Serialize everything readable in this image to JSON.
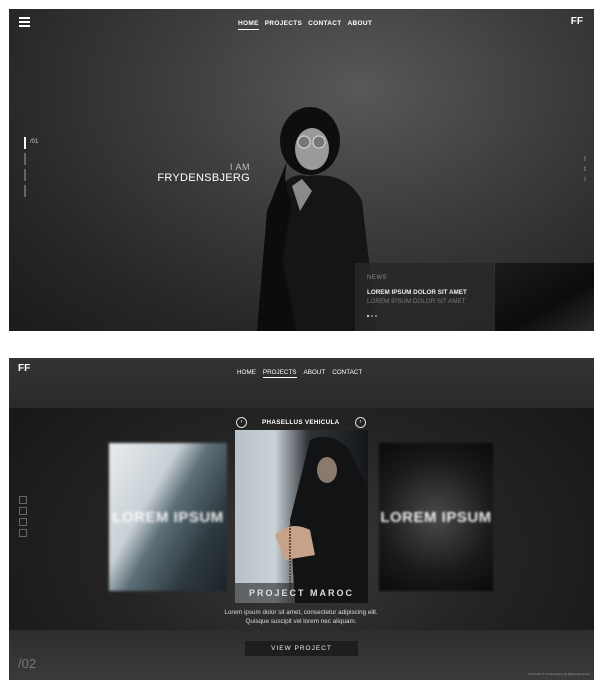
{
  "panel1": {
    "logo": "FF",
    "nav": [
      {
        "label": "HOME",
        "active": true
      },
      {
        "label": "PROJECTS",
        "active": false
      },
      {
        "label": "CONTACT",
        "active": false
      },
      {
        "label": "ABOUT",
        "active": false
      }
    ],
    "slide_number": "/01",
    "hero_line1": "I AM",
    "hero_line2": "FRYDENSBJERG",
    "social": [
      "f",
      "t",
      "i"
    ],
    "news": {
      "label": "NEWS",
      "title": "LOREM IPSUM DOLOR SIT AMET",
      "subtitle": "LOREM IPSUM DOLOR SIT AMET"
    }
  },
  "panel2": {
    "logo": "FF",
    "nav": [
      {
        "label": "HOME",
        "active": false
      },
      {
        "label": "PROJECTS",
        "active": true
      },
      {
        "label": "ABOUT",
        "active": false
      },
      {
        "label": "CONTACT",
        "active": false
      }
    ],
    "carousel_title": "PHASELLUS VEHICULA",
    "prev_arrow": "‹",
    "next_arrow": "›",
    "left_card_label": "LOREM IPSUM",
    "center_card_label": "PROJECT MAROC",
    "right_card_label": "LOREM IPSUM",
    "description_line1": "Lorem ipsum dolor sit amet, consectetur adipiscing elit.",
    "description_line2": "Quisque suscipit vel lorem nec aliquam.",
    "button_label": "VIEW PROJECT",
    "slide_number": "/02",
    "copyright": "All Credits © Frydensbjerg All Rights Reserved"
  }
}
